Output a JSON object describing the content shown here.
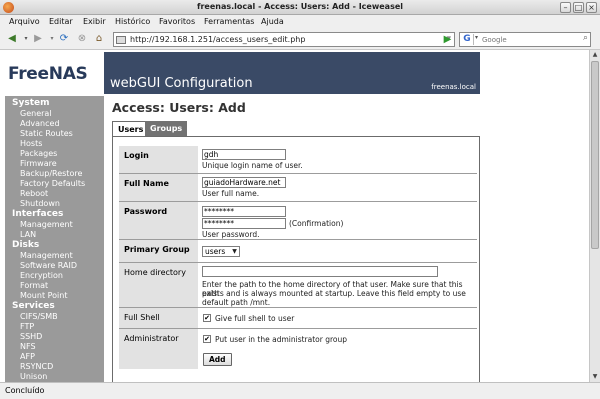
{
  "window": {
    "title": "freenas.local - Access: Users: Add - Iceweasel"
  },
  "menu": [
    "Arquivo",
    "Editar",
    "Exibir",
    "Histórico",
    "Favoritos",
    "Ferramentas",
    "Ajuda"
  ],
  "nav": {
    "url": "http://192.168.1.251/access_users_edit.php",
    "search_placeholder": "Google"
  },
  "status": "Concluído",
  "page": {
    "logo": "FreeNAS",
    "header": "webGUI Configuration",
    "host": "freenas.local",
    "title": "Access: Users: Add",
    "tabs": [
      "Users",
      "Groups"
    ]
  },
  "sidebar": {
    "system": "System",
    "system_items": [
      "General",
      "Advanced",
      "Static Routes",
      "Hosts",
      "Packages",
      "Firmware",
      "Backup/Restore",
      "Factory Defaults",
      "Reboot",
      "Shutdown"
    ],
    "interfaces": "Interfaces",
    "interfaces_items": [
      "Management",
      "LAN"
    ],
    "disks": "Disks",
    "disks_items": [
      "Management",
      "Software RAID",
      "Encryption",
      "Format",
      "Mount Point"
    ],
    "services": "Services",
    "services_items": [
      "CIFS/SMB",
      "FTP",
      "SSHD",
      "NFS",
      "AFP",
      "RSYNCD",
      "Unison"
    ]
  },
  "form": {
    "login": {
      "label": "Login",
      "value": "gdh",
      "hint": "Unique login name of user."
    },
    "fullname": {
      "label": "Full Name",
      "value": "guiadoHardware.net",
      "hint": "User full name."
    },
    "password": {
      "label": "Password",
      "value": "********",
      "confirm_value": "********",
      "confirm_label": "(Confirmation)",
      "hint": "User password."
    },
    "group": {
      "label": "Primary Group",
      "value": "users"
    },
    "home": {
      "label": "Home directory",
      "value": "",
      "hint_lines": [
        "Enter the path to the home directory of that user. Make sure that this path",
        "exists and is always mounted at startup. Leave this field empty to use",
        "default path /mnt."
      ]
    },
    "shell": {
      "label": "Full Shell",
      "checkbox_label": "Give full shell to user",
      "checked": true
    },
    "admin": {
      "label": "Administrator",
      "checkbox_label": "Put user in the administrator group",
      "checked": true
    },
    "add_button": "Add"
  }
}
